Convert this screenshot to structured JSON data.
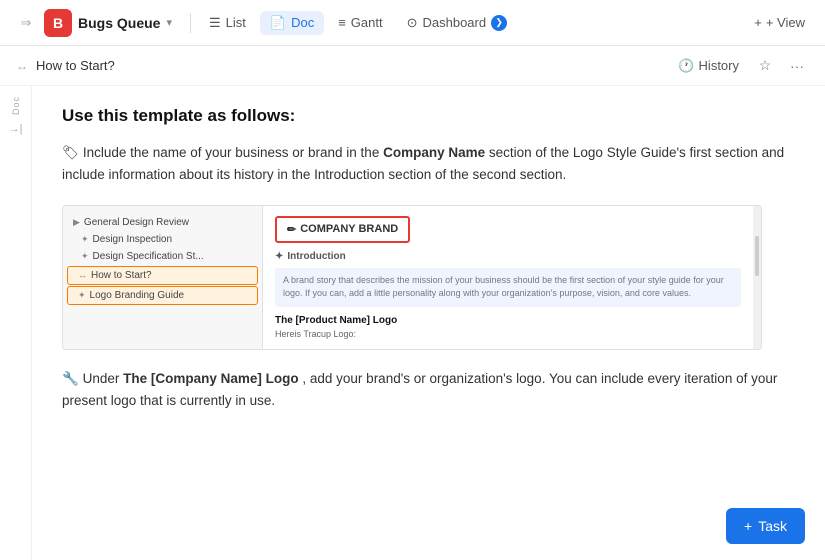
{
  "nav": {
    "expand_icon": "⇒",
    "logo_letter": "B",
    "workspace_name": "Bugs Queue",
    "workspace_chevron": "▾",
    "tabs": [
      {
        "id": "list",
        "icon": "☰",
        "label": "List",
        "active": false
      },
      {
        "id": "doc",
        "icon": "📄",
        "label": "Doc",
        "active": true
      },
      {
        "id": "gantt",
        "icon": "≡",
        "label": "Gantt",
        "active": false
      },
      {
        "id": "dashboard",
        "icon": "⊙",
        "label": "Dashboard",
        "active": false
      }
    ],
    "plus_label": "+ View"
  },
  "breadcrumb": {
    "arrows": "↔",
    "page_title": "How to Start?",
    "history_icon": "🕐",
    "history_label": "History",
    "star_icon": "☆",
    "more_icon": "···"
  },
  "sidebar": {
    "doc_label": "Doc",
    "arrow_label": "→|"
  },
  "doc": {
    "heading": "Use this template as follows:",
    "paragraph1_emoji": "🏷",
    "paragraph1_text": " Include the name of your business or brand in the ",
    "paragraph1_bold": "Company Name",
    "paragraph1_text2": " section of the Logo Style Guide's first section and include information about its history in the Introduction section of the second section.",
    "embedded_image": {
      "tree_items": [
        {
          "label": "General Design Review",
          "icon": "▶",
          "indent": 0
        },
        {
          "label": "Design Inspection",
          "icon": "✦",
          "indent": 1
        },
        {
          "label": "Design Specification St...",
          "icon": "✦",
          "indent": 1
        }
      ],
      "tree_items_selected": [
        {
          "label": "How to Start?",
          "icon": "↔",
          "selected": true
        },
        {
          "label": "Logo Branding Guide",
          "icon": "✦",
          "selected": true
        }
      ],
      "right_panel": {
        "company_brand_icon": "✏",
        "company_brand_text": "COMPANY BRAND",
        "intro_icon": "✦",
        "intro_label": "Introduction",
        "body_text": "A brand story that describes the mission of your business should be the first section of your style guide for your logo. If you can, add a little personality along with your organization's purpose, vision, and core values.",
        "product_logo_label": "The [Product Name] Logo",
        "tracup_text": "Hereis Tracup Logo:"
      }
    },
    "paragraph2_emoji": "🔧",
    "paragraph2_prefix": "Under ",
    "paragraph2_bold": "The [Company Name] Logo",
    "paragraph2_text": ", add your brand's or organization's logo. You can include every iteration of your present logo that is currently in use."
  },
  "task_button": {
    "icon": "+",
    "label": "Task"
  }
}
